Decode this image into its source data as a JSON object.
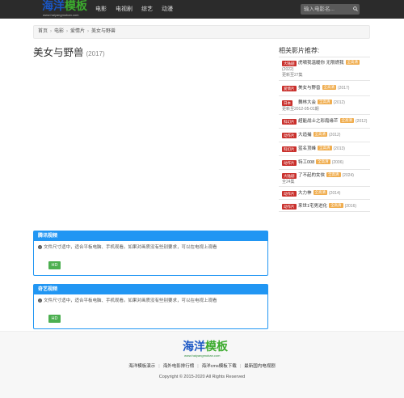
{
  "logo": {
    "main_a": "海洋",
    "main_b": "模板",
    "sub": "www.haiyangmoban.com"
  },
  "nav": [
    "电影",
    "电视剧",
    "综艺",
    "动漫"
  ],
  "search": {
    "placeholder": "输入电影名..."
  },
  "breadcrumb": [
    "首页",
    "电影",
    "爱情片",
    "美女与野兽"
  ],
  "movie": {
    "title": "美女与野兽",
    "year": "(2017)"
  },
  "related": {
    "title": "相关影片推荐:",
    "items": [
      {
        "tag": "大陆剧",
        "name": "虎啸我温暖你 无限燃我",
        "hd": "全高清",
        "year": "(2022)",
        "extra": "更新至27集"
      },
      {
        "tag": "爱情片",
        "name": "美女与野兽",
        "hd": "全高清",
        "year": "(2017)",
        "extra": ""
      },
      {
        "tag": "日本",
        "name": "舞林大会",
        "hd": "全高清",
        "year": "(2012)",
        "extra": "更新至2012-05-01期"
      },
      {
        "tag": "科幻片",
        "name": "超能战士之彩霞缘芒",
        "hd": "全高清",
        "year": "(2012)",
        "extra": ""
      },
      {
        "tag": "动作片",
        "name": "大追捕",
        "hd": "全高清",
        "year": "(2012)",
        "extra": ""
      },
      {
        "tag": "科幻片",
        "name": "蓝名顶峰",
        "hd": "全高清",
        "year": "(2013)",
        "extra": ""
      },
      {
        "tag": "动作片",
        "name": "特工008",
        "hd": "全高清",
        "year": "(2006)",
        "extra": ""
      },
      {
        "tag": "大陆剧",
        "name": "了不起的女侠",
        "hd": "全高清",
        "year": "(2024)",
        "extra": "全24集"
      },
      {
        "tag": "动作片",
        "name": "大力神",
        "hd": "全高清",
        "year": "(2014)",
        "extra": ""
      },
      {
        "tag": "动作片",
        "name": "来世1宅男进化",
        "hd": "全高清",
        "year": "(2016)",
        "extra": ""
      }
    ]
  },
  "players": [
    {
      "title": "腾讯视频",
      "info": "文件尺寸适中，适合平板电脑、手机观看。如果对画质没有些别要求，可以在电视上观看",
      "button": "HD"
    },
    {
      "title": "奇艺视频",
      "info": "文件尺寸适中，适合平板电脑、手机观看。如果对画质没有些别要求，可以在电视上观看",
      "button": "HD"
    }
  ],
  "footer": {
    "logo_a": "海洋",
    "logo_b": "模板",
    "logo_sub": "www.haiyangmoban.com",
    "links": [
      "海洋模板演示",
      "海外电影排行榜",
      "海洋cms模板下载",
      "最新国内电视剧"
    ],
    "copyright": "Copyright © 2015-2020 All Rights Reserved"
  },
  "colors": {
    "navbar": "#2b2b2b",
    "accent": "#2196f3",
    "tag": "#c9302c",
    "hd_badge": "#f0ad4e",
    "hd_button": "#4caf50"
  }
}
